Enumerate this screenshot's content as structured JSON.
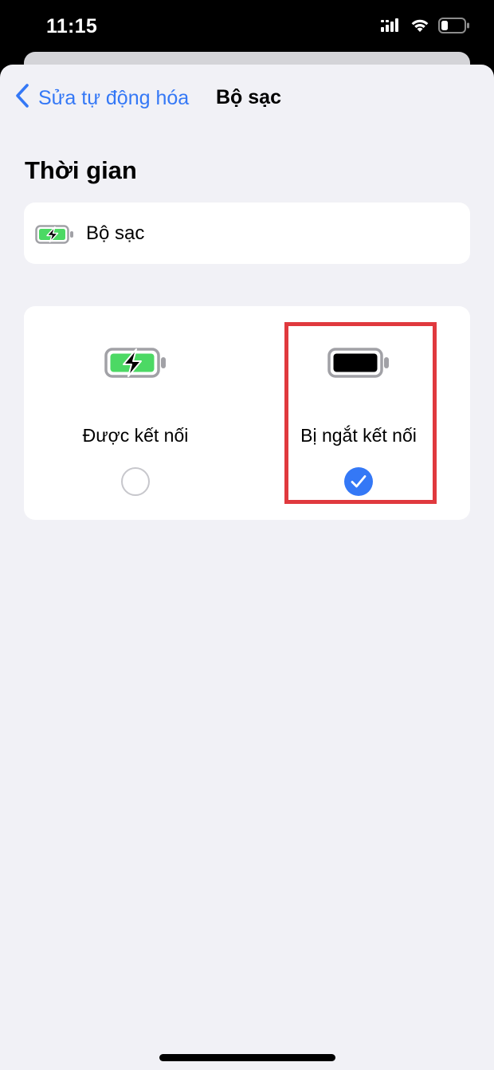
{
  "status_bar": {
    "time": "11:15",
    "icons": [
      "cellular-signal-icon",
      "wifi-icon",
      "battery-low-icon"
    ]
  },
  "nav": {
    "back_label": "Sửa tự động hóa",
    "back_icon": "chevron-left-icon",
    "title": "Bộ sạc"
  },
  "section": {
    "title": "Thời gian"
  },
  "trigger": {
    "icon": "battery-charging-icon",
    "label": "Bộ sạc"
  },
  "options": [
    {
      "icon": "battery-charging-icon",
      "label": "Được kết nối",
      "selected": false
    },
    {
      "icon": "battery-full-icon",
      "label": "Bị ngắt kết nối",
      "selected": true
    }
  ],
  "colors": {
    "accent": "#3478f6",
    "highlight": "#e0393e",
    "battery_green": "#4cd964",
    "background": "#f1f1f6"
  }
}
